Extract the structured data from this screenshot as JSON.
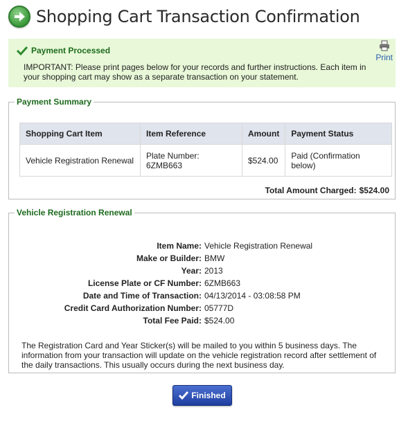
{
  "header": {
    "title": "Shopping Cart Transaction Confirmation",
    "icon": "arrow-right-circle-icon",
    "icon_color": "#3a9a3a"
  },
  "notice": {
    "title": "Payment Processed",
    "body": "IMPORTANT: Please print pages below for your records and further instructions. Each item in your shopping cart may show as a separate transaction on your statement.",
    "print_label": "Print",
    "background": "#e8f8d8"
  },
  "summary": {
    "legend": "Payment Summary",
    "columns": [
      "Shopping Cart Item",
      "Item Reference",
      "Amount",
      "Payment Status"
    ],
    "rows": [
      [
        "Vehicle Registration Renewal",
        "Plate Number: 6ZMB663",
        "$524.00",
        "Paid (Confirmation below)"
      ]
    ],
    "total_label": "Total Amount Charged:",
    "total_value": "$524.00"
  },
  "details": {
    "legend": "Vehicle Registration Renewal",
    "fields": [
      {
        "label": "Item Name:",
        "value": "Vehicle Registration Renewal"
      },
      {
        "label": "Make or Builder:",
        "value": "BMW"
      },
      {
        "label": "Year:",
        "value": "2013"
      },
      {
        "label": "License Plate or CF Number:",
        "value": "6ZMB663"
      },
      {
        "label": "Date and Time of Transaction:",
        "value": "04/13/2014 - 03:08:58 PM"
      },
      {
        "label": "Credit Card Authorization Number:",
        "value": "05777D"
      },
      {
        "label": "Total Fee Paid:",
        "value": "$524.00"
      }
    ],
    "note": "The Registration Card and Year Sticker(s) will be mailed to you within 5 business days. The information from your transaction will update on the vehicle registration record after settlement of the daily transactions. This usually occurs during the next business day."
  },
  "finish_button": {
    "label": "Finished",
    "color": "#1f3fa0"
  }
}
